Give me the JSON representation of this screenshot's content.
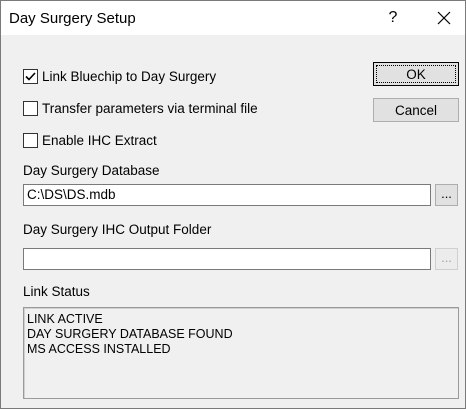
{
  "window": {
    "title": "Day Surgery Setup",
    "help_label": "?",
    "close_label": "✕"
  },
  "options": {
    "link_bluechip": {
      "label": "Link Bluechip to Day Surgery",
      "checked": true
    },
    "transfer_params": {
      "label": "Transfer parameters via terminal file",
      "checked": false
    },
    "enable_ihc": {
      "label": "Enable IHC Extract",
      "checked": false
    }
  },
  "buttons": {
    "ok_label": "OK",
    "cancel_label": "Cancel"
  },
  "database": {
    "label": "Day Surgery Database",
    "value": "C:\\DS\\DS.mdb",
    "browse_label": "..."
  },
  "ihc_output": {
    "label": "Day Surgery IHC Output Folder",
    "value": "",
    "browse_label": "..."
  },
  "link_status": {
    "label": "Link Status",
    "lines": [
      "LINK ACTIVE",
      "DAY SURGERY DATABASE FOUND",
      "MS ACCESS INSTALLED"
    ]
  }
}
